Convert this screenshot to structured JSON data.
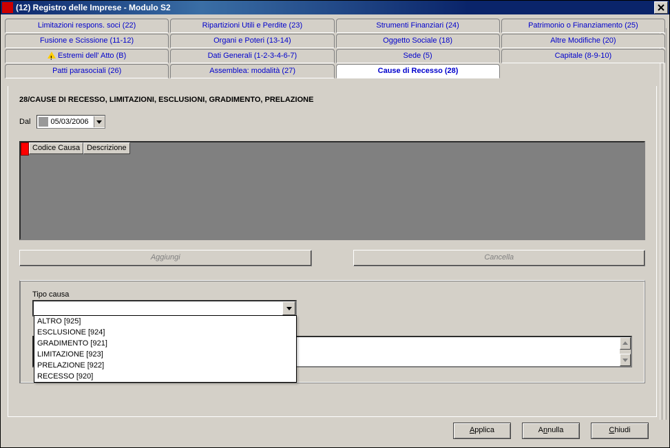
{
  "window": {
    "title": "(12) Registro delle Imprese - Modulo S2"
  },
  "tabs": {
    "row1": [
      "Limitazioni respons. soci (22)",
      "Ripartizioni Utili e Perdite (23)",
      "Strumenti Finanziari (24)",
      "Patrimonio o Finanziamento (25)"
    ],
    "row2": [
      "Fusione e Scissione (11-12)",
      "Organi e Poteri (13-14)",
      "Oggetto Sociale (18)",
      "Altre Modifiche (20)"
    ],
    "row3": [
      "Estremi dell' Atto (B)",
      "Dati Generali (1-2-3-4-6-7)",
      "Sede (5)",
      "Capitale (8-9-10)"
    ],
    "row4": [
      "Patti parasociali (26)",
      "Assemblea: modalità (27)",
      "Cause di Recesso (28)"
    ],
    "active": "Cause di Recesso (28)"
  },
  "panel": {
    "section_title": "28/CAUSE DI RECESSO, LIMITAZIONI, ESCLUSIONI, GRADIMENTO, PRELAZIONE",
    "dal_label": "Dal",
    "dal_value": "05/03/2006",
    "grid_headers": [
      "Codice Causa",
      "Descrizione"
    ],
    "aggiungi_label": "Aggiungi",
    "cancella_label": "Cancella",
    "tipo_causa_label": "Tipo causa",
    "tipo_causa_value": "",
    "tipo_causa_options": [
      "ALTRO [925]",
      "ESCLUSIONE [924]",
      "GRADIMENTO [921]",
      "LIMITAZIONE [923]",
      "PRELAZIONE [922]",
      "RECESSO [920]"
    ]
  },
  "footer": {
    "applica": "Applica",
    "annulla": "Annulla",
    "chiudi": "Chiudi"
  }
}
